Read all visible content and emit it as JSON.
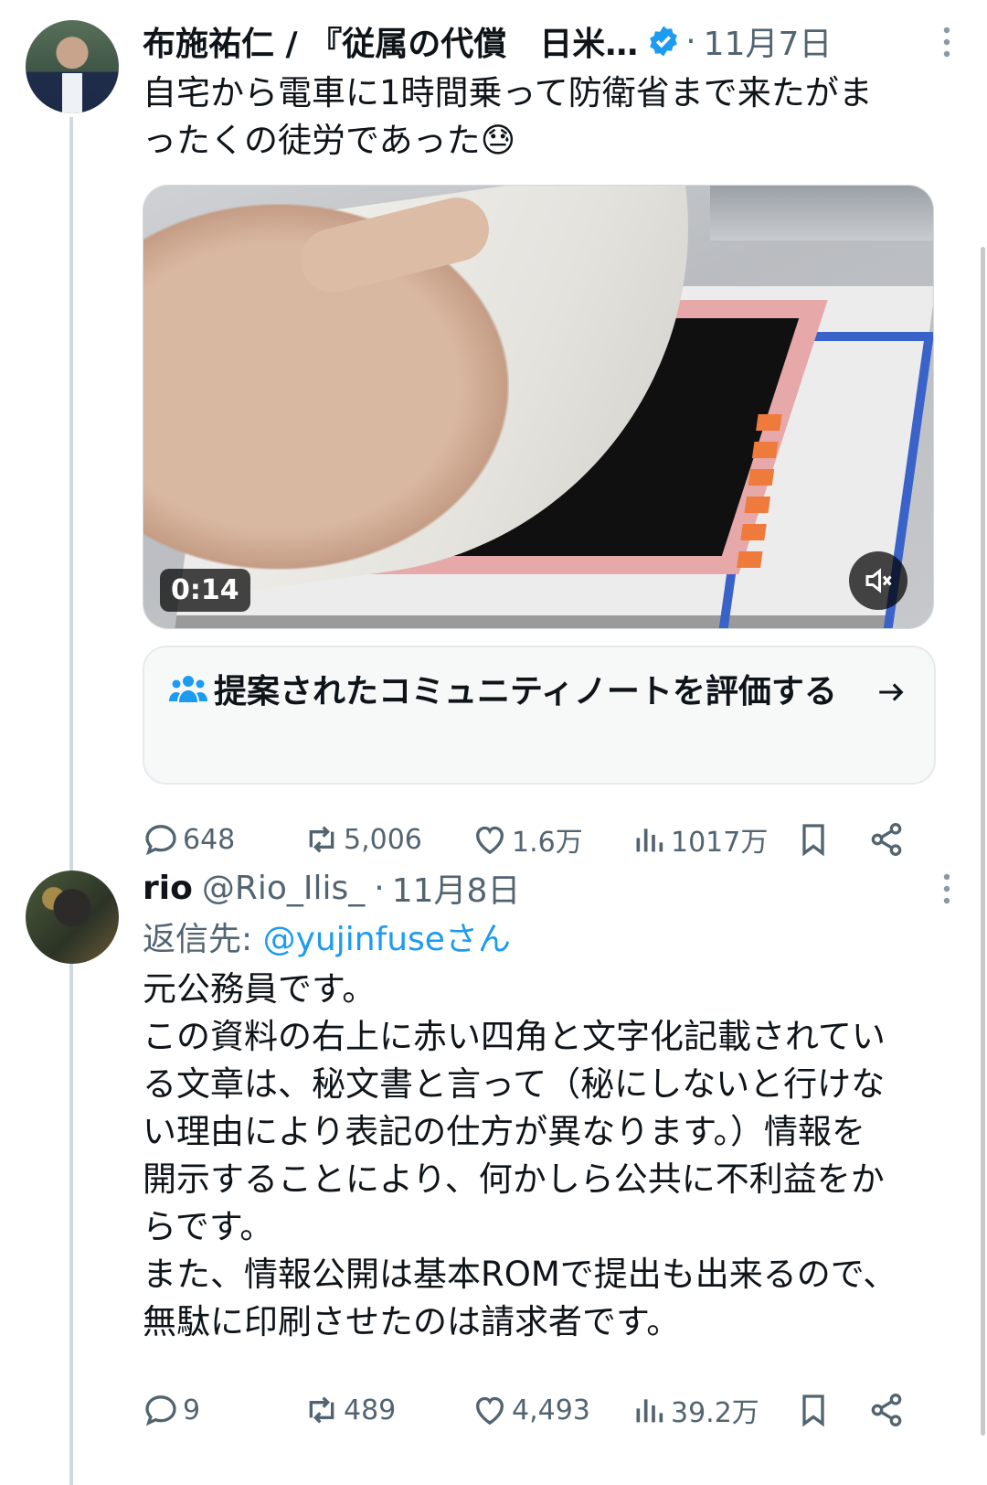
{
  "tweet1": {
    "author_name": "布施祐仁 / 『従属の代償　日米…",
    "dot": "·",
    "date": "11月7日",
    "text_line1": "自宅から電車に1時間乗って防衛省まで来たがま",
    "text_line2": "ったくの徒労であった😓",
    "video": {
      "duration": "0:14",
      "muted": true
    },
    "community_note": {
      "label": "提案されたコミュニティノートを評価する",
      "icon": "people-icon",
      "arrow": "arrow-right-icon"
    },
    "stats": {
      "replies": "648",
      "reposts": "5,006",
      "likes": "1.6万",
      "views": "1017万"
    }
  },
  "tweet2": {
    "author_name": "rio",
    "handle": "@Rio_Ilis_",
    "dot": "·",
    "date": "11月8日",
    "reply_prefix": "返信先: ",
    "reply_target": "@yujinfuseさん",
    "lines": [
      "元公務員です。",
      "この資料の右上に赤い四角と文字化記載されてい",
      "る文章は、秘文書と言って（秘にしないと行けな",
      "い理由により表記の仕方が異なります。）情報を",
      "開示することにより、何かしら公共に不利益をか",
      "らです。",
      "また、情報公開は基本ROMで提出も出来るので、",
      "無駄に印刷させたのは請求者です。"
    ],
    "stats": {
      "replies": "9",
      "reposts": "489",
      "likes": "4,493",
      "views": "39.2万"
    }
  },
  "colors": {
    "accent": "#1d9bf0",
    "muted": "#536471",
    "text": "#0f1419",
    "thread_line": "#cfd9de"
  }
}
